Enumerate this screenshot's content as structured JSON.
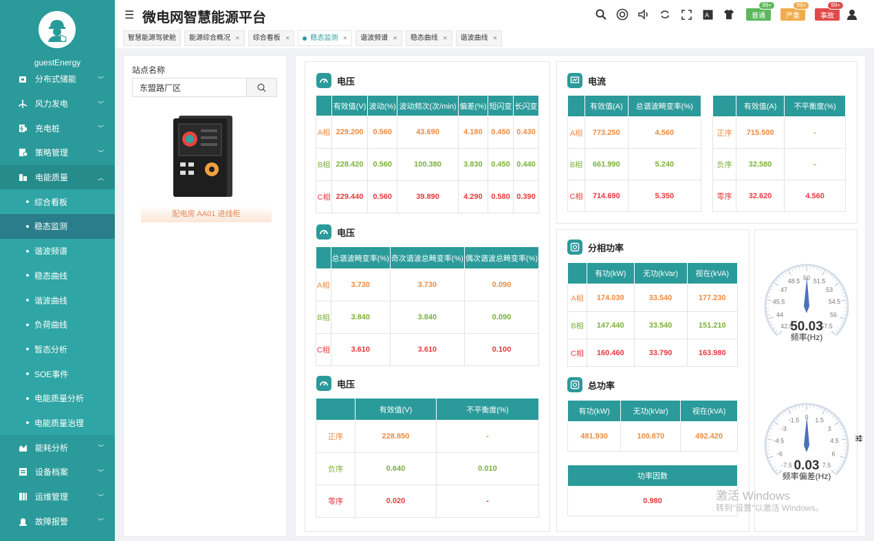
{
  "app": {
    "title": "微电网智慧能源平台"
  },
  "user": {
    "name": "guestEnergy"
  },
  "header": {
    "alarms": [
      {
        "label": "普通",
        "count": "99+",
        "color": "#5cb85c"
      },
      {
        "label": "严重",
        "count": "99+",
        "color": "#f0ad4e"
      },
      {
        "label": "事故",
        "count": "99+",
        "color": "#e14a4a"
      }
    ]
  },
  "tabs": [
    {
      "label": "智慧能源驾驶舱"
    },
    {
      "label": "能源综合概况"
    },
    {
      "label": "综合看板"
    },
    {
      "label": "稳态监测"
    },
    {
      "label": "谐波频谱"
    },
    {
      "label": "稳态曲线"
    },
    {
      "label": "谐波曲线"
    }
  ],
  "sidebar": {
    "items": [
      {
        "label": "分布式储能"
      },
      {
        "label": "风力发电"
      },
      {
        "label": "充电桩"
      },
      {
        "label": "策略管理"
      },
      {
        "label": "电能质量"
      },
      {
        "label": "能耗分析"
      },
      {
        "label": "设备档案"
      },
      {
        "label": "运维管理"
      },
      {
        "label": "故障报警"
      }
    ],
    "subitems": [
      {
        "label": "综合看板"
      },
      {
        "label": "稳态监测"
      },
      {
        "label": "谐波频谱"
      },
      {
        "label": "稳态曲线"
      },
      {
        "label": "谐波曲线"
      },
      {
        "label": "负荷曲线"
      },
      {
        "label": "暂态分析"
      },
      {
        "label": "SOE事件"
      },
      {
        "label": "电能质量分析"
      },
      {
        "label": "电能质量治理"
      }
    ]
  },
  "left": {
    "site_label": "站点名称",
    "site_value": "东盟路厂区",
    "device_label": "配电房 AA01 进线柜"
  },
  "voltage1": {
    "title": "电压",
    "headers": [
      "有效值(V)",
      "波动(%)",
      "波动频次(次/min)",
      "偏差(%)",
      "短闪变",
      "长闪变"
    ],
    "rows": [
      {
        "label": "A相",
        "values": [
          "229.200",
          "0.560",
          "43.690",
          "4.180",
          "0.450",
          "0.430"
        ]
      },
      {
        "label": "B相",
        "values": [
          "228.420",
          "0.560",
          "100.380",
          "3.830",
          "0.450",
          "0.440"
        ]
      },
      {
        "label": "C相",
        "values": [
          "229.440",
          "0.560",
          "39.890",
          "4.290",
          "0.580",
          "0.390"
        ]
      }
    ]
  },
  "voltage2": {
    "title": "电压",
    "headers": [
      "总谐波畸变率(%)",
      "奇次谐波总畸变率(%)",
      "偶次谐波总畸变率(%)"
    ],
    "rows": [
      {
        "label": "A相",
        "values": [
          "3.730",
          "3.730",
          "0.090"
        ]
      },
      {
        "label": "B相",
        "values": [
          "3.840",
          "3.840",
          "0.090"
        ]
      },
      {
        "label": "C相",
        "values": [
          "3.610",
          "3.610",
          "0.100"
        ]
      }
    ]
  },
  "voltage3": {
    "title": "电压",
    "headers": [
      "有效值(V)",
      "不平衡度(%)"
    ],
    "rows": [
      {
        "label": "正序",
        "values": [
          "228.850",
          "-"
        ]
      },
      {
        "label": "负序",
        "values": [
          "0.640",
          "0.010"
        ]
      },
      {
        "label": "零序",
        "values": [
          "0.020",
          "-"
        ]
      }
    ]
  },
  "current": {
    "title": "电流",
    "headers": [
      "有效值(A)",
      "总谐波畸变率(%)"
    ],
    "rows": [
      {
        "label": "A相",
        "values": [
          "773.250",
          "4.560"
        ]
      },
      {
        "label": "B相",
        "values": [
          "661.990",
          "5.240"
        ]
      },
      {
        "label": "C相",
        "values": [
          "714.690",
          "5.350"
        ]
      }
    ],
    "headers2": [
      "有效值(A)",
      "不平衡度(%)"
    ],
    "rows2": [
      {
        "label": "正序",
        "values": [
          "715.500",
          "-"
        ]
      },
      {
        "label": "负序",
        "values": [
          "32.580",
          "-"
        ]
      },
      {
        "label": "零序",
        "values": [
          "32.620",
          "4.560"
        ]
      }
    ]
  },
  "phase_power": {
    "title": "分相功率",
    "headers": [
      "有功(kW)",
      "无功(kVar)",
      "视在(kVA)"
    ],
    "rows": [
      {
        "label": "A相",
        "values": [
          "174.030",
          "33.540",
          "177.230"
        ]
      },
      {
        "label": "B相",
        "values": [
          "147.440",
          "33.540",
          "151.210"
        ]
      },
      {
        "label": "C相",
        "values": [
          "160.460",
          "33.790",
          "163.980"
        ]
      }
    ]
  },
  "total_power": {
    "title": "总功率",
    "headers": [
      "有功(kW)",
      "无功(kVar)",
      "视在(kVA)"
    ],
    "values": [
      "481.930",
      "100.870",
      "492.420"
    ],
    "pf_label": "功率因数",
    "pf_value": "0.980"
  },
  "gauges": [
    {
      "value": "50.03",
      "label": "频率(Hz)",
      "ticks": [
        "42.5",
        "44",
        "45.5",
        "47",
        "48.5",
        "50",
        "51.5",
        "53",
        "54.5",
        "56",
        "57.5"
      ],
      "min": 42.5,
      "max": 57.5,
      "reading": 50.03
    },
    {
      "value": "0.03",
      "label": "频率偏差(Hz)",
      "ticks": [
        "-7.5",
        "-6",
        "-4.5",
        "-3",
        "-1.5",
        "0",
        "1.5",
        "3",
        "4.5",
        "6",
        "7.5"
      ],
      "min": -7.5,
      "max": 7.5,
      "reading": 0.03
    }
  ],
  "watermark": {
    "line1": "激活 Windows",
    "line2": "转到\"设置\"以激活 Windows。"
  }
}
